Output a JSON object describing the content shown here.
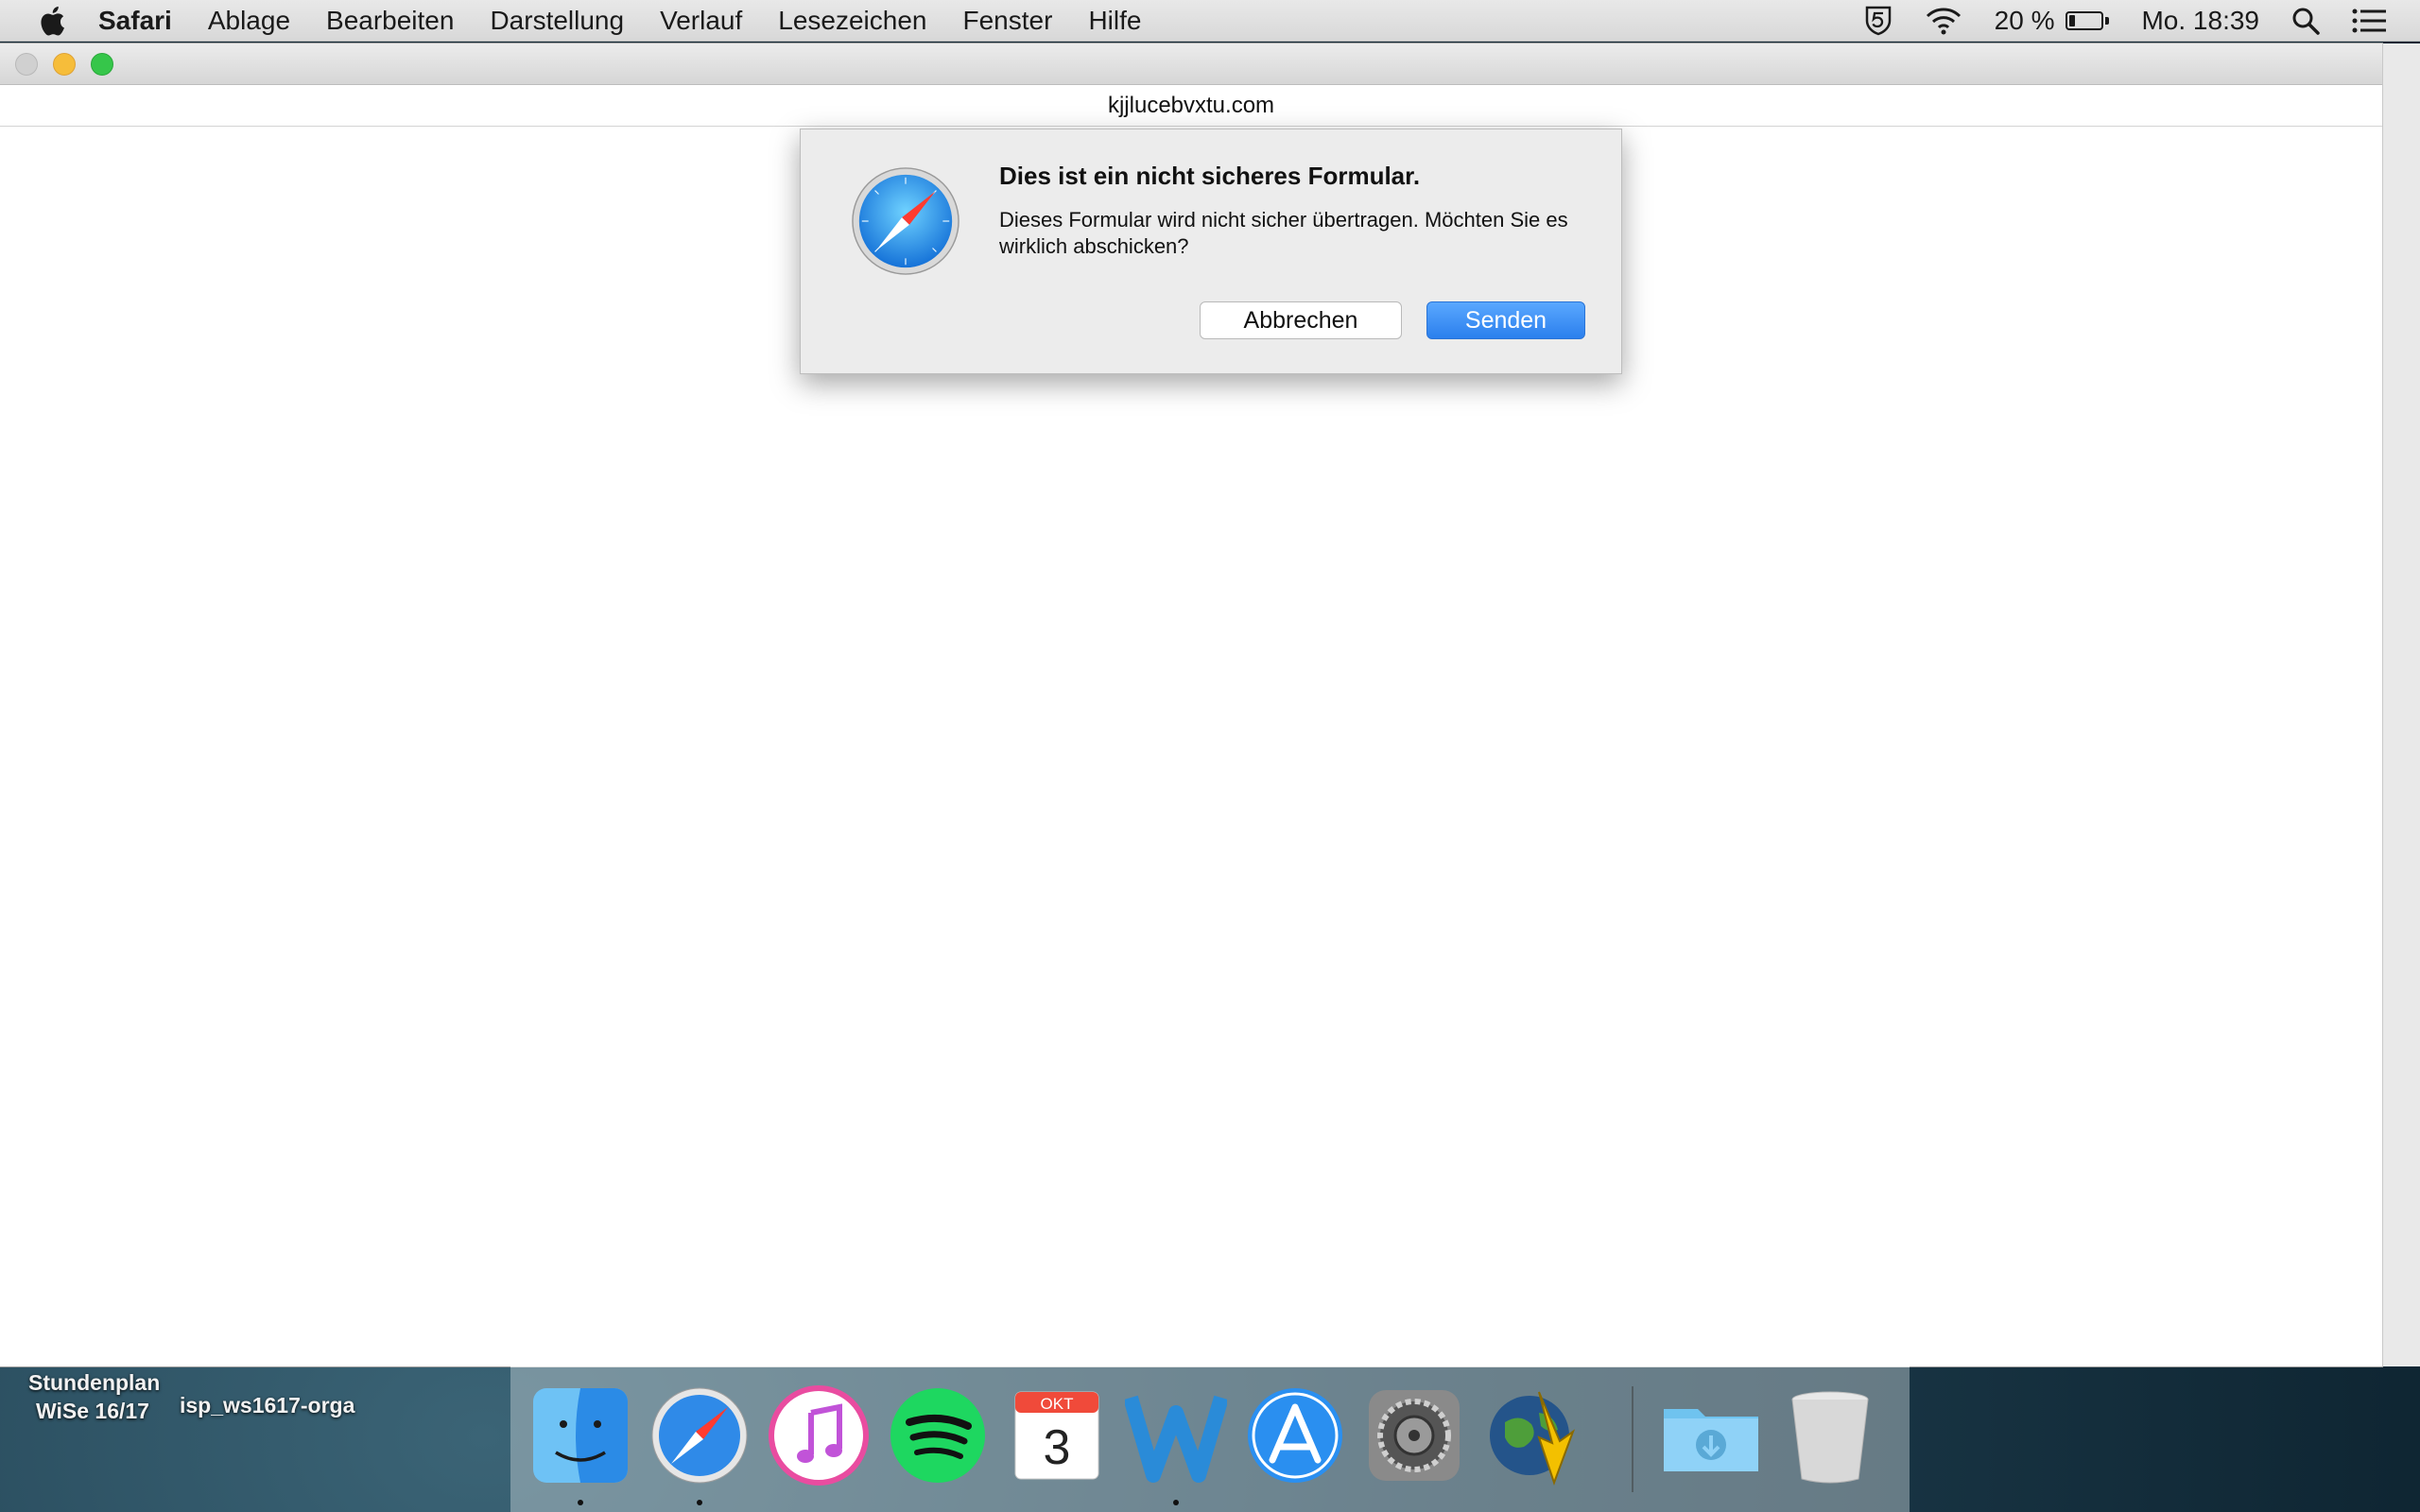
{
  "menubar": {
    "app_name": "Safari",
    "items": [
      "Ablage",
      "Bearbeiten",
      "Darstellung",
      "Verlauf",
      "Lesezeichen",
      "Fenster",
      "Hilfe"
    ],
    "battery_text": "20 %",
    "battery_level": 0.2,
    "clock": "Mo. 18:39"
  },
  "window": {
    "url": "kjjlucebvxtu.com"
  },
  "dialog": {
    "title": "Dies ist ein nicht sicheres Formular.",
    "message": "Dieses Formular wird nicht sicher übertragen. Möchten Sie es wirklich abschicken?",
    "cancel_label": "Abbrechen",
    "send_label": "Senden"
  },
  "desktop": {
    "icon1_label_line1": "Stundenplan",
    "icon1_label_line2": "WiSe 16/17",
    "icon2_label": "isp_ws1617-orga"
  },
  "calendar_icon": {
    "month": "OKT",
    "day": "3"
  },
  "colors": {
    "accent": "#2b7fed",
    "window_bg": "#ffffff",
    "dialog_bg": "#ececec"
  }
}
